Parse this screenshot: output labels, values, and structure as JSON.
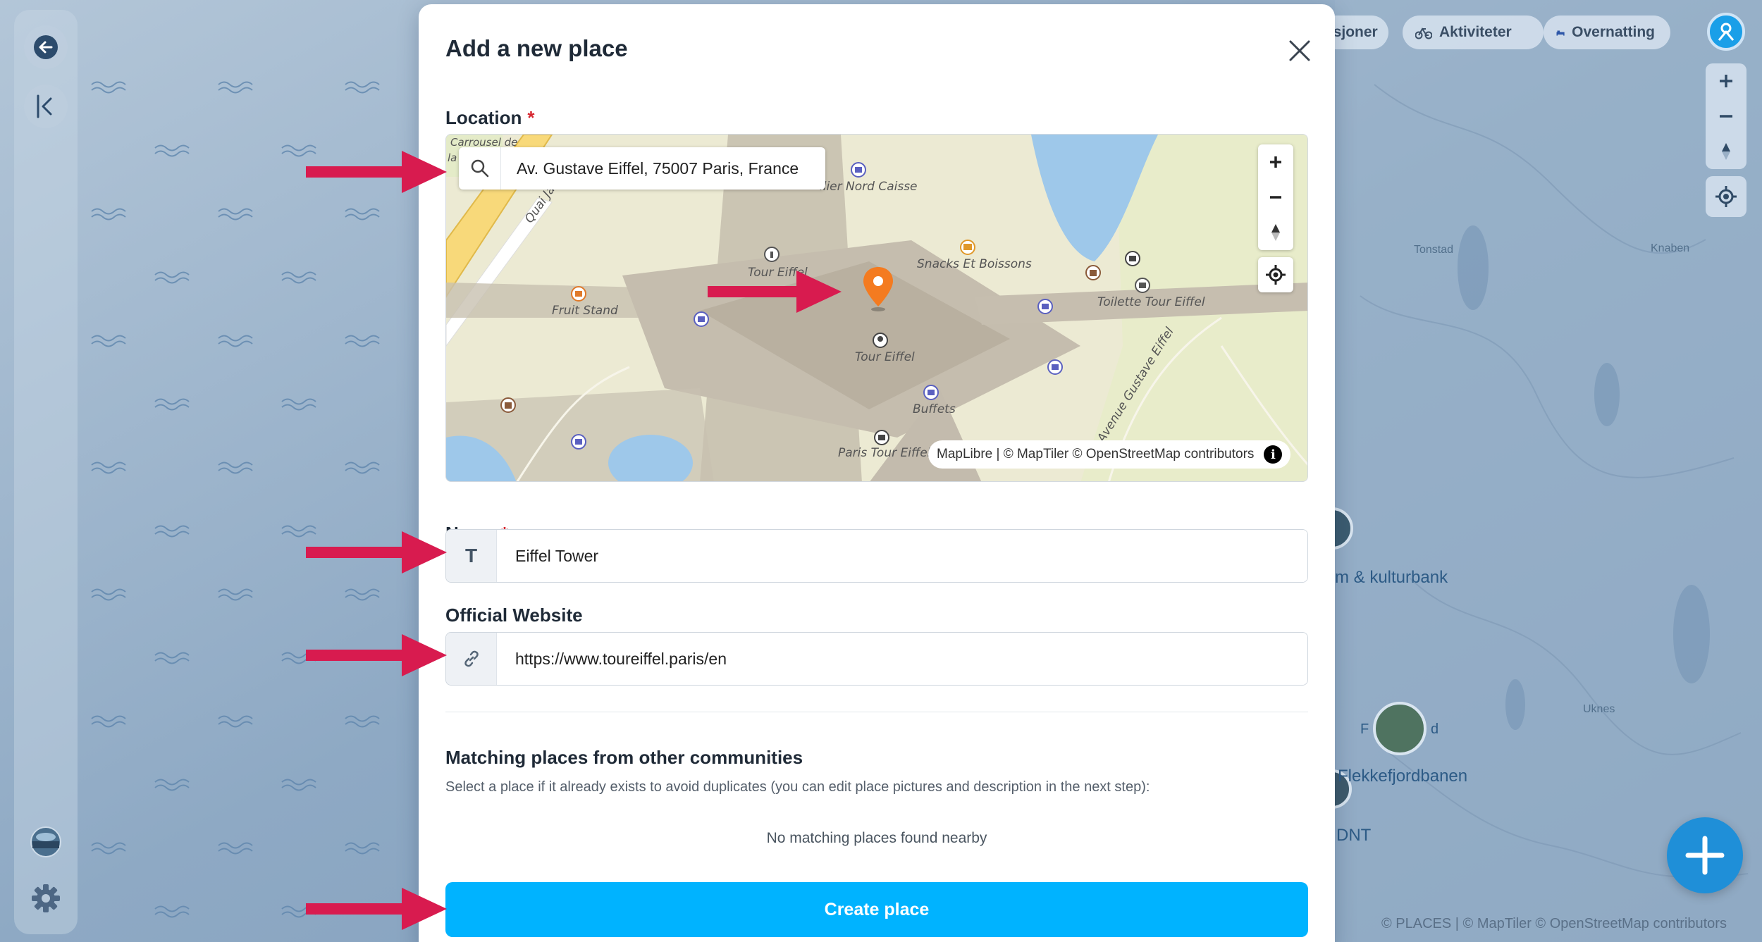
{
  "background_map": {
    "labels": {
      "museum_partial": "m & kulturbank",
      "railway_partial": "Flekkefjordbanen",
      "dnt_partial": "DNT",
      "tonstad": "Tonstad",
      "knaben": "Knaben",
      "uknes": "Uknes",
      "f_letter": "F",
      "d_letter": "d"
    },
    "attribution": "© PLACES | © MapTiler © OpenStreetMap contributors"
  },
  "top_chips": {
    "attractions": "ksjoner",
    "activities": "Aktiviteter",
    "accommodation": "Overnatting"
  },
  "dialog": {
    "title": "Add a new place",
    "location": {
      "label": "Location",
      "required_mark": "*",
      "search_value": "Av. Gustave Eiffel, 75007 Paris, France",
      "map_attribution": "MapLibre | © MapTiler © OpenStreetMap contributors",
      "info_glyph": "i",
      "poi_labels": {
        "carrousel": "Carrousel de",
        "carrousel_2": "la",
        "quai": "Quai Jacq",
        "nord_caisse": "ilier Nord Caisse",
        "tour_eiffel_top": "Tour Eiffel",
        "snacks": "Snacks Et Boissons",
        "fruit_stand": "Fruit Stand",
        "toilette": "Toilette Tour Eiffel",
        "tour_eiffel_mid": "Tour Eiffel",
        "buffets": "Buffets",
        "avenue": "Avenue Gustave Eiffel",
        "paris_tour_eiffel": "Paris Tour Eiffel"
      }
    },
    "name": {
      "label": "Name",
      "required_mark": "*",
      "prefix": "T",
      "value": "Eiffel Tower"
    },
    "website": {
      "label": "Official Website",
      "value": "https://www.toureiffel.paris/en"
    },
    "matching": {
      "title": "Matching places from other communities",
      "help": "Select a place if it already exists to avoid duplicates (you can edit place pictures and description in the next step):",
      "empty": "No matching places found nearby"
    },
    "create_label": "Create place"
  },
  "colors": {
    "primary_button": "#00b3ff",
    "arrow": "#d81b4f",
    "pin": "#f47b20",
    "required": "#d6262f"
  }
}
